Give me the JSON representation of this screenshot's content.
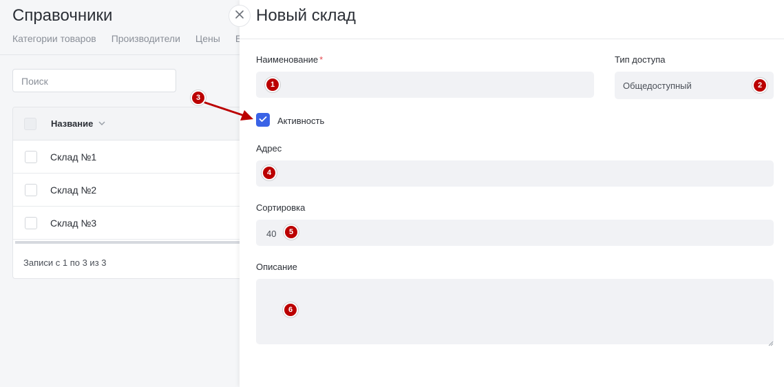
{
  "background": {
    "title": "Справочники",
    "tabs": [
      "Категории товаров",
      "Производители",
      "Цены",
      "Ед"
    ],
    "search_placeholder": "Поиск",
    "table": {
      "column_header": "Название",
      "rows": [
        "Склад №1",
        "Склад №2",
        "Склад №3"
      ],
      "footer": "Записи с 1 по 3 из 3"
    }
  },
  "drawer": {
    "title": "Новый склад",
    "fields": {
      "name_label": "Наименование",
      "required_mark": "*",
      "access_label": "Тип доступа",
      "access_value": "Общедоступный",
      "active_label": "Активность",
      "active_checked": true,
      "address_label": "Адрес",
      "sort_label": "Сортировка",
      "sort_value": "40",
      "description_label": "Описание"
    }
  },
  "annotations": [
    "1",
    "2",
    "3",
    "4",
    "5",
    "6"
  ],
  "colors": {
    "accent": "#3a63e6",
    "marker": "#b00000",
    "required": "#e5484d"
  },
  "icons": {
    "close": "close-icon",
    "sort": "chevron-down-icon",
    "check": "check-icon"
  }
}
